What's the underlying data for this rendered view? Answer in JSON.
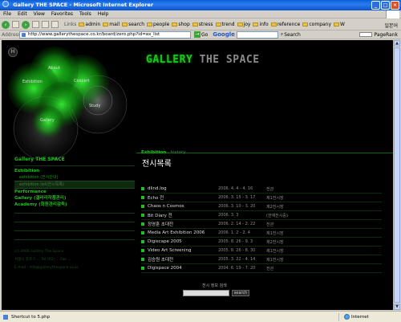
{
  "window": {
    "title": "Gallery THE SPACE - Microsoft Internet Explorer"
  },
  "menu": [
    "File",
    "Edit",
    "View",
    "Favorites",
    "Tools",
    "Help"
  ],
  "links": {
    "label": "Links",
    "items": [
      "admin",
      "mail",
      "search",
      "people",
      "shop",
      "stress",
      "trend",
      "joy",
      "info",
      "reference",
      "company",
      "W"
    ]
  },
  "toolbar": {
    "lang": "일본어"
  },
  "address": {
    "label": "Address",
    "url": "http://www.gallerythespace.co.kr/board/zero.php?id=ex_list",
    "go": "Go"
  },
  "google": {
    "logo": "Google",
    "search_label": "Search",
    "pagerank_label": "PageRank"
  },
  "site": {
    "logo_green": "GALLERY",
    "logo_gray": " THE SPACE",
    "bubbles": [
      "About",
      "Exhibition",
      "Concert",
      "Study",
      "Gallery"
    ],
    "home": "H",
    "left_menu": {
      "head": "Gallery THE SPACE",
      "exhibition": "Exhibition",
      "exhibition_sub": "exhibition (전시안내)",
      "active": "exhibition list(전시목록)",
      "performance": "Performance",
      "gallery_sub": "Gallery (갤러리작품관리)",
      "academy": "Academy (회원관리감독)",
      "copyright": "(c) 2006 Gallery The Space",
      "address": "서울시 종로구 ... Tel (02) ... Fax ...",
      "email": "E-mail : info@gallerythespace.co.kr"
    },
    "crumb": {
      "main": "Exhibition",
      "sub": " - history"
    },
    "title": "전시목록",
    "list": [
      {
        "title": "dlind.log",
        "date": "2006. 4. 4 - 4. 16",
        "place": "전관"
      },
      {
        "title": "Echo 전",
        "date": "2006. 3. 15 - 3. 17",
        "place": "제1전시장"
      },
      {
        "title": "Chaos n Cosmos",
        "date": "2006. 3. 10 - 3. 20",
        "place": "제2전시장"
      },
      {
        "title": "Bit Diary 전",
        "date": "2006. 3. 3",
        "place": "(한재전시중)"
      },
      {
        "title": "정영훈 초대전",
        "date": "2006. 2. 14 - 2. 22",
        "place": "전관"
      },
      {
        "title": "Media Art Exhibition 2006",
        "date": "2006. 1. 2 - 2. 4",
        "place": "제1전시장"
      },
      {
        "title": "Digiscape 2005",
        "date": "2005. 8. 26 - 9. 3",
        "place": "제2전시장"
      },
      {
        "title": "Video Art Screening",
        "date": "2005. 8. 26 - 8. 30",
        "place": "제1전시장"
      },
      {
        "title": "김승원 초대전",
        "date": "2005. 3. 22 - 4. 14",
        "place": "제1전시장"
      },
      {
        "title": "Digispace 2004",
        "date": "2004. 6. 19 - 7. 20",
        "place": "전관"
      }
    ],
    "search_label": "전시 정보 검색",
    "search_button": "search"
  },
  "status": {
    "text": "Shortcut to 5.php",
    "zone": "Internet"
  },
  "colors": {
    "accent_green": "#1fc11f",
    "title_blue": "#0a5fd8",
    "background": "#000000"
  }
}
